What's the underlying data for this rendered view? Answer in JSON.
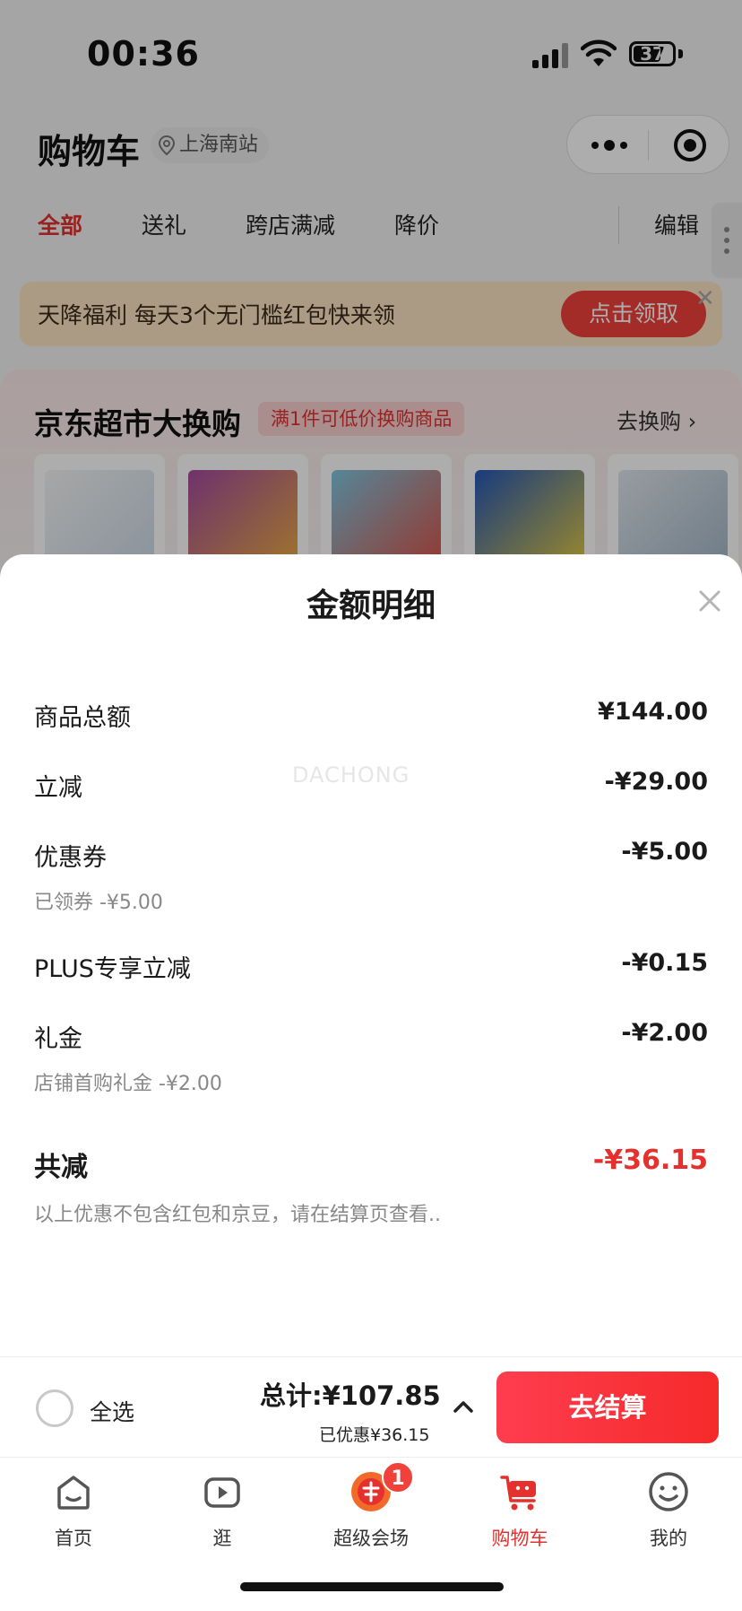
{
  "status_bar": {
    "time": "00:36",
    "battery": "37"
  },
  "header": {
    "title": "购物车",
    "location": "上海南站"
  },
  "tabs": {
    "all": "全部",
    "gift": "送礼",
    "cross_store": "跨店满减",
    "price_drop": "降价",
    "edit": "编辑"
  },
  "promo": {
    "text": "天降福利 每天3个无门槛红包快来领",
    "button": "点击领取"
  },
  "swap": {
    "title": "京东超市大换购",
    "tag": "满1件可低价换购商品",
    "link": "去换购 ›"
  },
  "sheet": {
    "title": "金额明细",
    "watermark": "DACHONG",
    "rows": [
      {
        "label": "商品总额",
        "value": "¥144.00"
      },
      {
        "label": "立减",
        "value": "-¥29.00"
      },
      {
        "label": "优惠券",
        "value": "-¥5.00",
        "sub": "已领券 -¥5.00"
      },
      {
        "label": "PLUS专享立减",
        "value": "-¥0.15"
      },
      {
        "label": "礼金",
        "value": "-¥2.00",
        "sub": "店铺首购礼金 -¥2.00"
      }
    ],
    "total_label": "共减",
    "total_value": "-¥36.15",
    "note": "以上优惠不包含红包和京豆，请在结算页查看.."
  },
  "checkout": {
    "select_all": "全选",
    "total": "总计:¥107.85",
    "saved": "已优惠¥36.15",
    "button": "去结算"
  },
  "tabbar": {
    "items": [
      {
        "label": "首页",
        "icon": "home-icon"
      },
      {
        "label": "逛",
        "icon": "video-icon"
      },
      {
        "label": "超级会场",
        "icon": "super-venue-icon",
        "badge": "1"
      },
      {
        "label": "购物车",
        "icon": "cart-icon",
        "active": true
      },
      {
        "label": "我的",
        "icon": "profile-icon"
      }
    ]
  },
  "colors": {
    "accent": "#e4312e",
    "checkout_button": "#f52a2a",
    "promo_bg": "#fde5c3"
  }
}
